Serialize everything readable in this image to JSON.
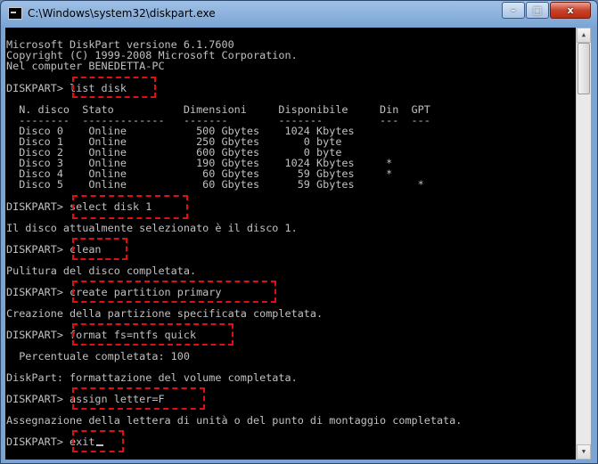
{
  "window": {
    "title": "C:\\Windows\\system32\\diskpart.exe",
    "min": "–",
    "max": "□",
    "close": "x"
  },
  "lines": [
    {
      "id": "header-1",
      "text": "Microsoft DiskPart versione 6.1.7600"
    },
    {
      "id": "header-2",
      "text": "Copyright (C) 1999-2008 Microsoft Corporation."
    },
    {
      "id": "header-3",
      "text": "Nel computer BENEDETTA-PC"
    },
    {
      "id": "prompt-list-disk",
      "text": "DISKPART> list disk"
    },
    {
      "id": "table-header",
      "text": "  N. disco  Stato           Dimensioni     Disponibile     Din  GPT"
    },
    {
      "id": "table-divider",
      "text": "  --------  -------------   -------        -------         ---  ---"
    },
    {
      "id": "row-disk-0",
      "text": "  Disco 0    Online           500 Gbytes    1024 Kbytes"
    },
    {
      "id": "row-disk-1",
      "text": "  Disco 1    Online           250 Gbytes       0 byte"
    },
    {
      "id": "row-disk-2",
      "text": "  Disco 2    Online           600 Gbytes       0 byte"
    },
    {
      "id": "row-disk-3",
      "text": "  Disco 3    Online           190 Gbytes    1024 Kbytes     *"
    },
    {
      "id": "row-disk-4",
      "text": "  Disco 4    Online            60 Gbytes      59 Gbytes     *"
    },
    {
      "id": "row-disk-5",
      "text": "  Disco 5    Online            60 Gbytes      59 Gbytes          *"
    },
    {
      "id": "prompt-select-disk",
      "text": "DISKPART> select disk 1"
    },
    {
      "id": "out-select",
      "text": "Il disco attualmente selezionato è il disco 1."
    },
    {
      "id": "prompt-clean",
      "text": "DISKPART> clean"
    },
    {
      "id": "out-clean",
      "text": "Pulitura del disco completata."
    },
    {
      "id": "prompt-create-partition",
      "text": "DISKPART> create partition primary"
    },
    {
      "id": "out-create",
      "text": "Creazione della partizione specificata completata."
    },
    {
      "id": "prompt-format",
      "text": "DISKPART> format fs=ntfs quick"
    },
    {
      "id": "out-percent",
      "text": "  Percentuale completata: 100"
    },
    {
      "id": "out-format",
      "text": "DiskPart: formattazione del volume completata."
    },
    {
      "id": "prompt-assign",
      "text": "DISKPART> assign letter=F"
    },
    {
      "id": "out-assign",
      "text": "Assegnazione della lettera di unità o del punto di montaggio completata."
    },
    {
      "id": "prompt-exit",
      "text": "DISKPART> exit"
    }
  ],
  "highlight_color": "#e01010"
}
